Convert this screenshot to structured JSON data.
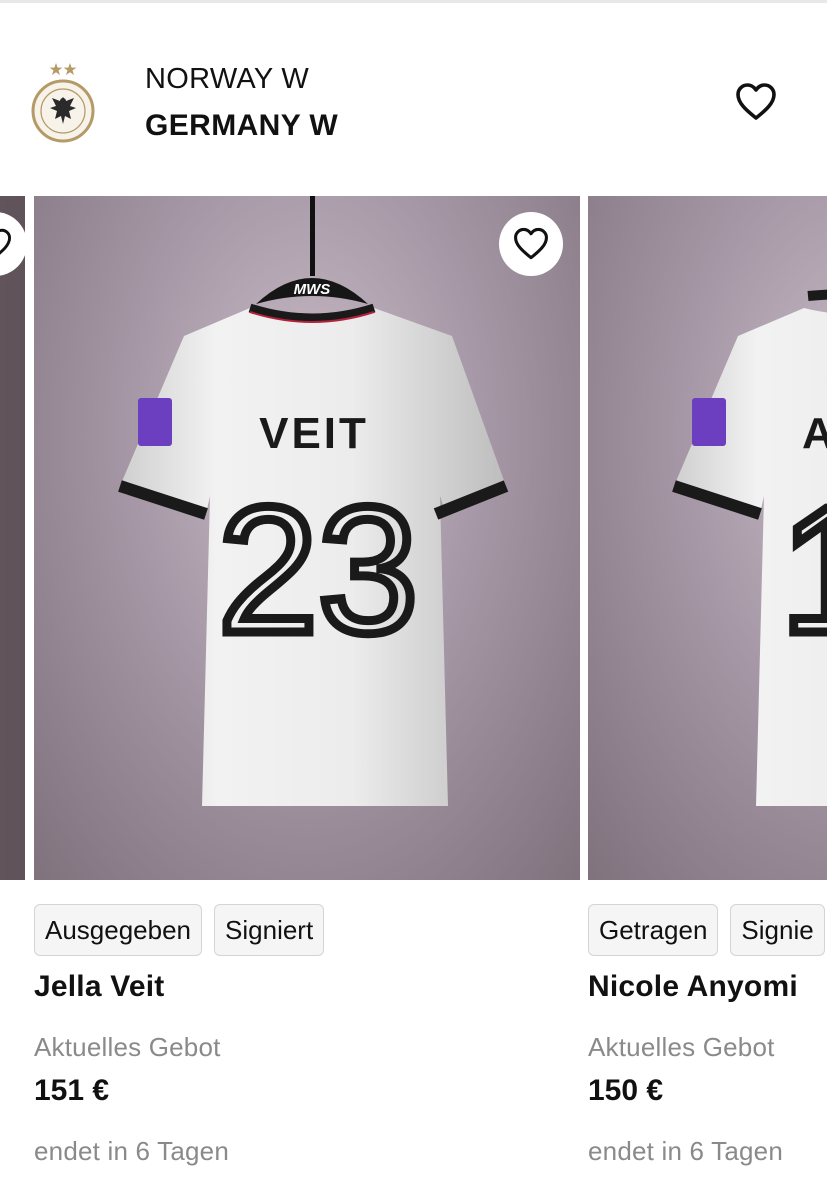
{
  "match": {
    "home_team": "NORWAY W",
    "away_team": "GERMANY W"
  },
  "icons": {
    "crest": "dfb-crest-icon",
    "favorite": "heart-outline-icon"
  },
  "cards": [
    {
      "jersey_name": "VEIT",
      "jersey_number": "23",
      "sponsor": "MWS",
      "tags": [
        "Ausgegeben",
        "Signiert"
      ],
      "player_name": "Jella Veit",
      "bid_label": "Aktuelles Gebot",
      "bid_value": "151 €",
      "ends_text": "endet in 6 Tagen"
    },
    {
      "jersey_name": "A",
      "jersey_number": "1",
      "tags": [
        "Getragen",
        "Signie"
      ],
      "player_name": "Nicole Anyomi",
      "bid_label": "Aktuelles Gebot",
      "bid_value": "150 €",
      "ends_text": "endet in 6 Tagen"
    }
  ],
  "colors": {
    "text": "#111111",
    "muted": "#8a8a8a",
    "tag_border": "#d4d4d4",
    "jersey_trim": "#1a1a1a",
    "trim_accent": "#b0233a",
    "badge_purple": "#6b3fc0"
  }
}
